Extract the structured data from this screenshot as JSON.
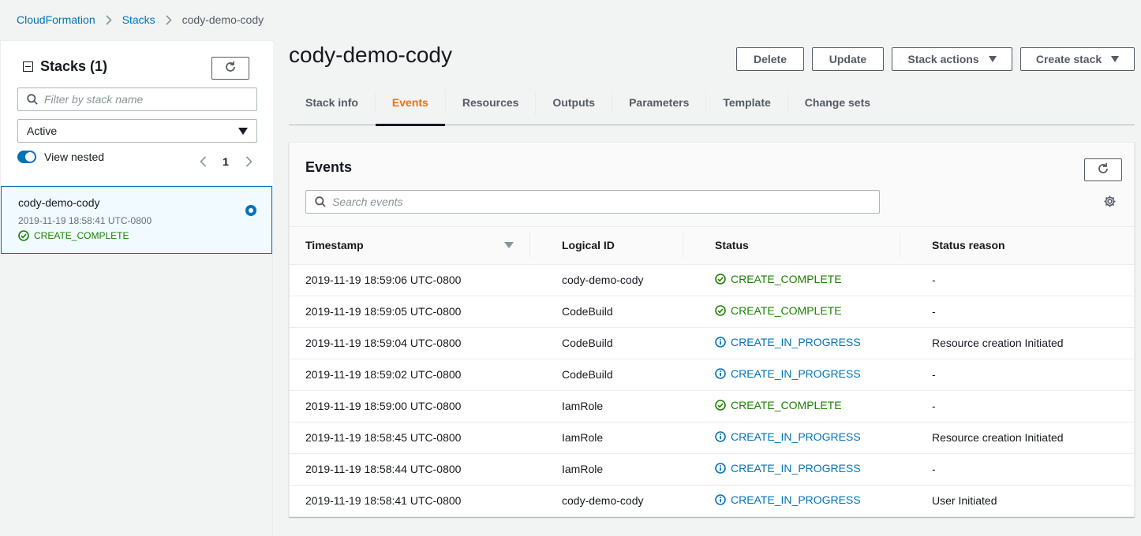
{
  "breadcrumb": [
    "CloudFormation",
    "Stacks",
    "cody-demo-cody"
  ],
  "sidebar": {
    "title": "Stacks",
    "count": "(1)",
    "filter_placeholder": "Filter by stack name",
    "status_filter": "Active",
    "view_nested_label": "View nested",
    "page": "1",
    "stack": {
      "name": "cody-demo-cody",
      "timestamp": "2019-11-19 18:58:41 UTC-0800",
      "status": "CREATE_COMPLETE"
    }
  },
  "main": {
    "title": "cody-demo-cody",
    "buttons": {
      "delete": "Delete",
      "update": "Update",
      "stack_actions": "Stack actions",
      "create_stack": "Create stack"
    },
    "tabs": [
      "Stack info",
      "Events",
      "Resources",
      "Outputs",
      "Parameters",
      "Template",
      "Change sets"
    ],
    "active_tab": "Events"
  },
  "events": {
    "title": "Events",
    "search_placeholder": "Search events",
    "columns": [
      "Timestamp",
      "Logical ID",
      "Status",
      "Status reason"
    ],
    "rows": [
      {
        "timestamp": "2019-11-19 18:59:06 UTC-0800",
        "logical_id": "cody-demo-cody",
        "status": "CREATE_COMPLETE",
        "reason": "-"
      },
      {
        "timestamp": "2019-11-19 18:59:05 UTC-0800",
        "logical_id": "CodeBuild",
        "status": "CREATE_COMPLETE",
        "reason": "-"
      },
      {
        "timestamp": "2019-11-19 18:59:04 UTC-0800",
        "logical_id": "CodeBuild",
        "status": "CREATE_IN_PROGRESS",
        "reason": "Resource creation Initiated"
      },
      {
        "timestamp": "2019-11-19 18:59:02 UTC-0800",
        "logical_id": "CodeBuild",
        "status": "CREATE_IN_PROGRESS",
        "reason": "-"
      },
      {
        "timestamp": "2019-11-19 18:59:00 UTC-0800",
        "logical_id": "IamRole",
        "status": "CREATE_COMPLETE",
        "reason": "-"
      },
      {
        "timestamp": "2019-11-19 18:58:45 UTC-0800",
        "logical_id": "IamRole",
        "status": "CREATE_IN_PROGRESS",
        "reason": "Resource creation Initiated"
      },
      {
        "timestamp": "2019-11-19 18:58:44 UTC-0800",
        "logical_id": "IamRole",
        "status": "CREATE_IN_PROGRESS",
        "reason": "-"
      },
      {
        "timestamp": "2019-11-19 18:58:41 UTC-0800",
        "logical_id": "cody-demo-cody",
        "status": "CREATE_IN_PROGRESS",
        "reason": "User Initiated"
      }
    ]
  },
  "colors": {
    "link": "#0073bb",
    "success": "#1d8102",
    "active_tab": "#ec7211"
  }
}
